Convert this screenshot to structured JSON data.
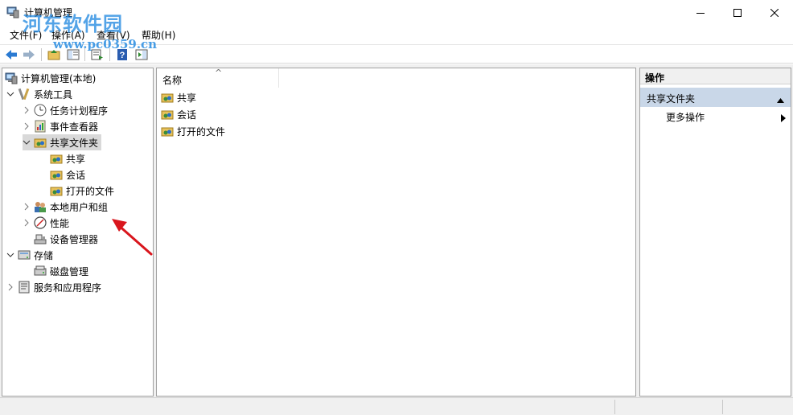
{
  "window": {
    "title": "计算机管理"
  },
  "menu": {
    "file": "文件(F)",
    "action": "操作(A)",
    "view": "查看(V)",
    "help": "帮助(H)"
  },
  "watermark": {
    "brand": "河东软件园",
    "url": "www.pc0359.cn"
  },
  "tree": {
    "root": "计算机管理(本地)",
    "system_tools": "系统工具",
    "task_scheduler": "任务计划程序",
    "event_viewer": "事件查看器",
    "shared_folders": "共享文件夹",
    "shares": "共享",
    "sessions": "会话",
    "open_files": "打开的文件",
    "local_users": "本地用户和组",
    "performance": "性能",
    "device_manager": "设备管理器",
    "storage": "存储",
    "disk_management": "磁盘管理",
    "services_apps": "服务和应用程序"
  },
  "list": {
    "column_name": "名称",
    "items": [
      "共享",
      "会话",
      "打开的文件"
    ]
  },
  "actions": {
    "header": "操作",
    "section": "共享文件夹",
    "more": "更多操作"
  },
  "colors": {
    "selected_row": "#d9d9d9",
    "action_section": "#c9d7e8",
    "arrow": "#d9161d"
  }
}
